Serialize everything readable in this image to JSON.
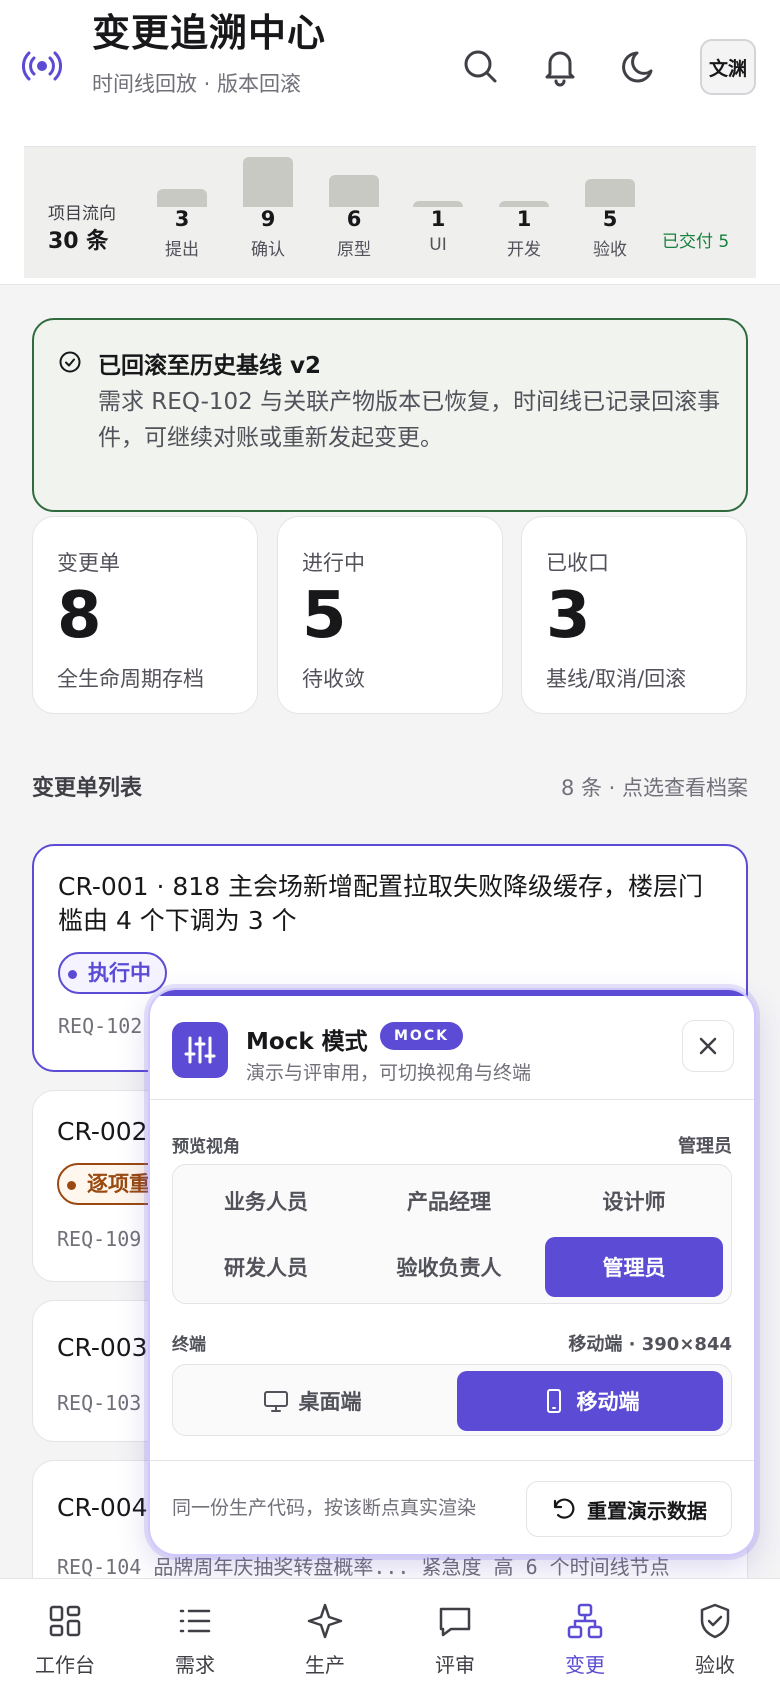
{
  "header": {
    "title": "变更追溯中心",
    "subtitle": "时间线回放 · 版本回滚",
    "avatar": "文渊"
  },
  "flow": {
    "label": "项目流向",
    "count": "30 条",
    "stages": [
      {
        "label": "提出",
        "count": "3"
      },
      {
        "label": "确认",
        "count": "9"
      },
      {
        "label": "原型",
        "count": "6"
      },
      {
        "label": "UI",
        "count": "1"
      },
      {
        "label": "开发",
        "count": "1"
      },
      {
        "label": "验收",
        "count": "5"
      }
    ],
    "delivered": "已交付 5"
  },
  "alert": {
    "title": "已回滚至历史基线 v2",
    "body": "需求 REQ-102 与关联产物版本已恢复，时间线已记录回滚事件，可继续对账或重新发起变更。"
  },
  "stats": [
    {
      "label": "变更单",
      "value": "8",
      "note": "全生命周期存档"
    },
    {
      "label": "进行中",
      "value": "5",
      "note": "待收敛"
    },
    {
      "label": "已收口",
      "value": "3",
      "note": "基线/取消/回滚"
    }
  ],
  "list": {
    "title": "变更单列表",
    "meta": "8 条 · 点选查看档案",
    "items": [
      {
        "title": "CR-001 · 818 主会场新增配置拉取失败降级缓存，楼层门槛由 4 个下调为 3 个",
        "status": "执行中",
        "meta": "REQ-102"
      },
      {
        "title": "CR-002",
        "status": "逐项重审",
        "meta": "REQ-109"
      },
      {
        "title": "CR-003",
        "meta": "REQ-103"
      },
      {
        "title": "CR-004",
        "meta": "REQ-104  品牌周年庆抽奖转盘概率...  紧急度 高  6 个时间线节点"
      }
    ]
  },
  "mock_panel": {
    "title": "Mock 模式",
    "tag": "MOCK",
    "desc": "演示与评审用，可切换视角与终端",
    "role_label": "预览视角",
    "role_value": "管理员",
    "roles": [
      "业务人员",
      "产品经理",
      "设计师",
      "研发人员",
      "验收负责人",
      "管理员"
    ],
    "active_role": "管理员",
    "device_label": "终端",
    "device_value": "移动端 · 390×844",
    "devices": [
      "桌面端",
      "移动端"
    ],
    "active_device": "移动端",
    "footer_note": "同一份生产代码，按该断点真实渲染",
    "reset_label": "重置演示数据"
  },
  "tabs": [
    {
      "label": "工作台",
      "icon": "grid-icon"
    },
    {
      "label": "需求",
      "icon": "list-icon"
    },
    {
      "label": "生产",
      "icon": "sparkle-icon"
    },
    {
      "label": "评审",
      "icon": "message-icon"
    },
    {
      "label": "变更",
      "icon": "network-icon"
    },
    {
      "label": "验收",
      "icon": "shield-check-icon"
    }
  ],
  "active_tab": "变更",
  "colors": {
    "accent": "#5b4bd5",
    "success": "#2f6b3d",
    "warning": "#9a4a10"
  }
}
